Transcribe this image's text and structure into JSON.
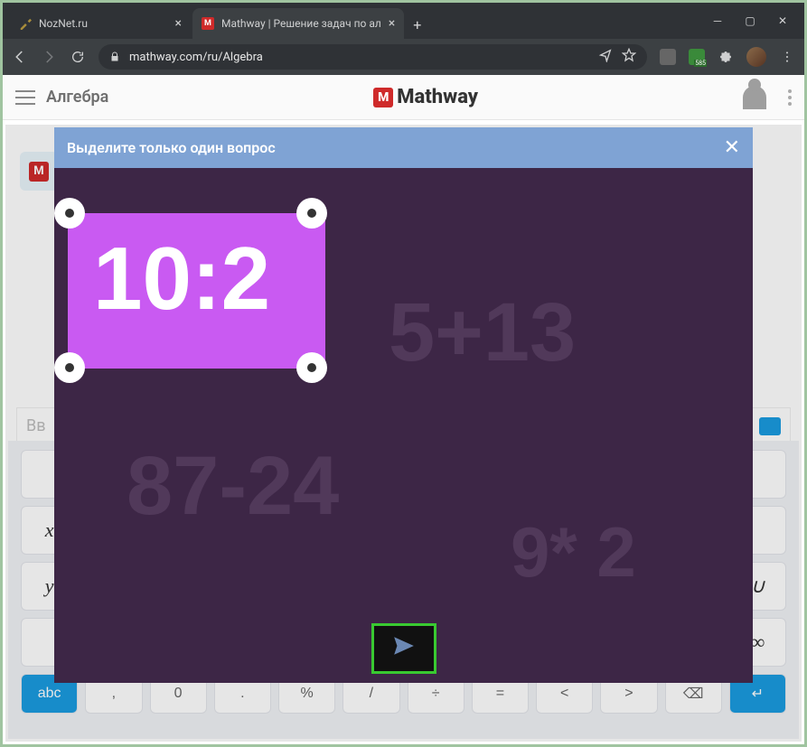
{
  "window": {
    "tab1_title": "NozNet.ru",
    "tab2_title": "Mathway | Решение задач по ал",
    "url": "mathway.com/ru/Algebra"
  },
  "mathway": {
    "subject": "Алгебра",
    "brand": "Mathway",
    "logo_letter": "M",
    "input_placeholder": "Вв",
    "chat_icon": "M"
  },
  "modal": {
    "title": "Выделите только один вопрос",
    "close": "✕",
    "selected_expr": "10:2",
    "expressions": {
      "a": "5+13",
      "b": "87-24",
      "c": "9* 2"
    },
    "submit_icon": "➤"
  },
  "keyboard": {
    "row_bottom": [
      "abc",
      ",",
      "0",
      ".",
      "%",
      "/",
      "÷",
      "=",
      "<",
      ">",
      "⌫",
      "↵"
    ]
  }
}
